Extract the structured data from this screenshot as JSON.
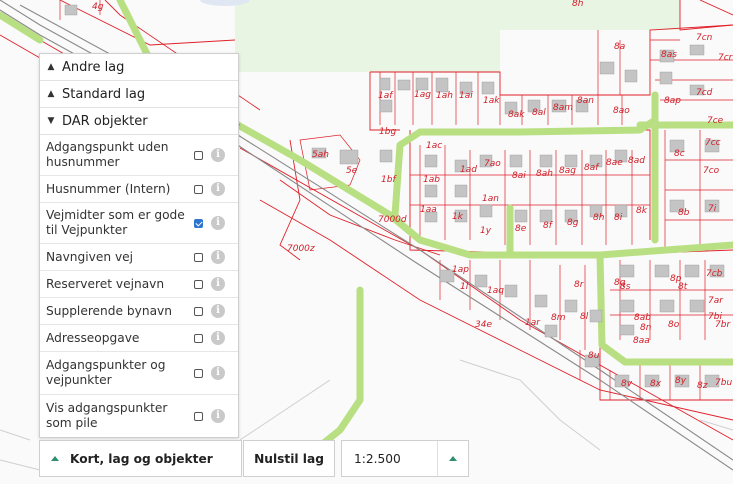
{
  "map": {
    "labels": [
      {
        "t": "4g"
      },
      {
        "t": "8h"
      },
      {
        "t": "8a"
      },
      {
        "t": "8as"
      },
      {
        "t": "7cn"
      },
      {
        "t": "7cr"
      },
      {
        "t": "1af"
      },
      {
        "t": "1ag"
      },
      {
        "t": "1ah"
      },
      {
        "t": "1ai"
      },
      {
        "t": "1ak"
      },
      {
        "t": "8ak"
      },
      {
        "t": "8al"
      },
      {
        "t": "8am"
      },
      {
        "t": "8an"
      },
      {
        "t": "8ao"
      },
      {
        "t": "8ap"
      },
      {
        "t": "7cd"
      },
      {
        "t": "1bg"
      },
      {
        "t": "5ah"
      },
      {
        "t": "5e"
      },
      {
        "t": "1bf"
      },
      {
        "t": "1ac"
      },
      {
        "t": "1ad"
      },
      {
        "t": "7ao"
      },
      {
        "t": "8ai"
      },
      {
        "t": "8ah"
      },
      {
        "t": "8ag"
      },
      {
        "t": "8af"
      },
      {
        "t": "8ae"
      },
      {
        "t": "8ad"
      },
      {
        "t": "8c"
      },
      {
        "t": "7ce"
      },
      {
        "t": "7cc"
      },
      {
        "t": "7co"
      },
      {
        "t": "1ab"
      },
      {
        "t": "1an"
      },
      {
        "t": "1aa"
      },
      {
        "t": "1k"
      },
      {
        "t": "1y"
      },
      {
        "t": "8e"
      },
      {
        "t": "8f"
      },
      {
        "t": "8g"
      },
      {
        "t": "8h"
      },
      {
        "t": "8i"
      },
      {
        "t": "8k"
      },
      {
        "t": "8b"
      },
      {
        "t": "7i"
      },
      {
        "t": "7000d"
      },
      {
        "t": "7000z"
      },
      {
        "t": "1ap"
      },
      {
        "t": "1l"
      },
      {
        "t": "1aq"
      },
      {
        "t": "8r"
      },
      {
        "t": "8q"
      },
      {
        "t": "8p"
      },
      {
        "t": "7cb"
      },
      {
        "t": "8s"
      },
      {
        "t": "8t"
      },
      {
        "t": "7ar"
      },
      {
        "t": "34e"
      },
      {
        "t": "1ar"
      },
      {
        "t": "8m"
      },
      {
        "t": "8l"
      },
      {
        "t": "8ab"
      },
      {
        "t": "7bi"
      },
      {
        "t": "7br"
      },
      {
        "t": "8o"
      },
      {
        "t": "8n"
      },
      {
        "t": "8u"
      },
      {
        "t": "8aa"
      },
      {
        "t": "8v"
      },
      {
        "t": "8x"
      },
      {
        "t": "8y"
      },
      {
        "t": "8z"
      },
      {
        "t": "7bu"
      }
    ]
  },
  "panel": {
    "sections": [
      {
        "label": "Andre lag",
        "chevron": "^"
      },
      {
        "label": "Standard lag",
        "chevron": "^"
      },
      {
        "label": "DAR objekter",
        "chevron": "v"
      }
    ],
    "layers": [
      {
        "label": "Adgangspunkt uden husnummer",
        "checked": false
      },
      {
        "label": "Husnummer (Intern)",
        "checked": false
      },
      {
        "label": "Vejmidter som er gode til Vejpunkter",
        "checked": true
      },
      {
        "label": "Navngiven vej",
        "checked": false
      },
      {
        "label": "Reserveret vejnavn",
        "checked": false
      },
      {
        "label": "Supplerende bynavn",
        "checked": false
      },
      {
        "label": "Adresseopgave",
        "checked": false
      },
      {
        "label": "Adgangspunkter og vejpunkter",
        "checked": false
      },
      {
        "label": "Vis adgangspunkter som pile",
        "checked": false
      }
    ],
    "info_glyph": "i"
  },
  "bottombar": {
    "toggle_label": "Kort, lag og objekter",
    "reset_label": "Nulstil lag",
    "scale_value": "1:2.500"
  },
  "colors": {
    "road": "#b9df83",
    "parcel": "#e0202a",
    "building": "#c4c4c4",
    "rail": "#8a8a8a",
    "green_area": "#e8f5e2",
    "check": "#2f74d0",
    "arrow": "#2f8f6f"
  }
}
